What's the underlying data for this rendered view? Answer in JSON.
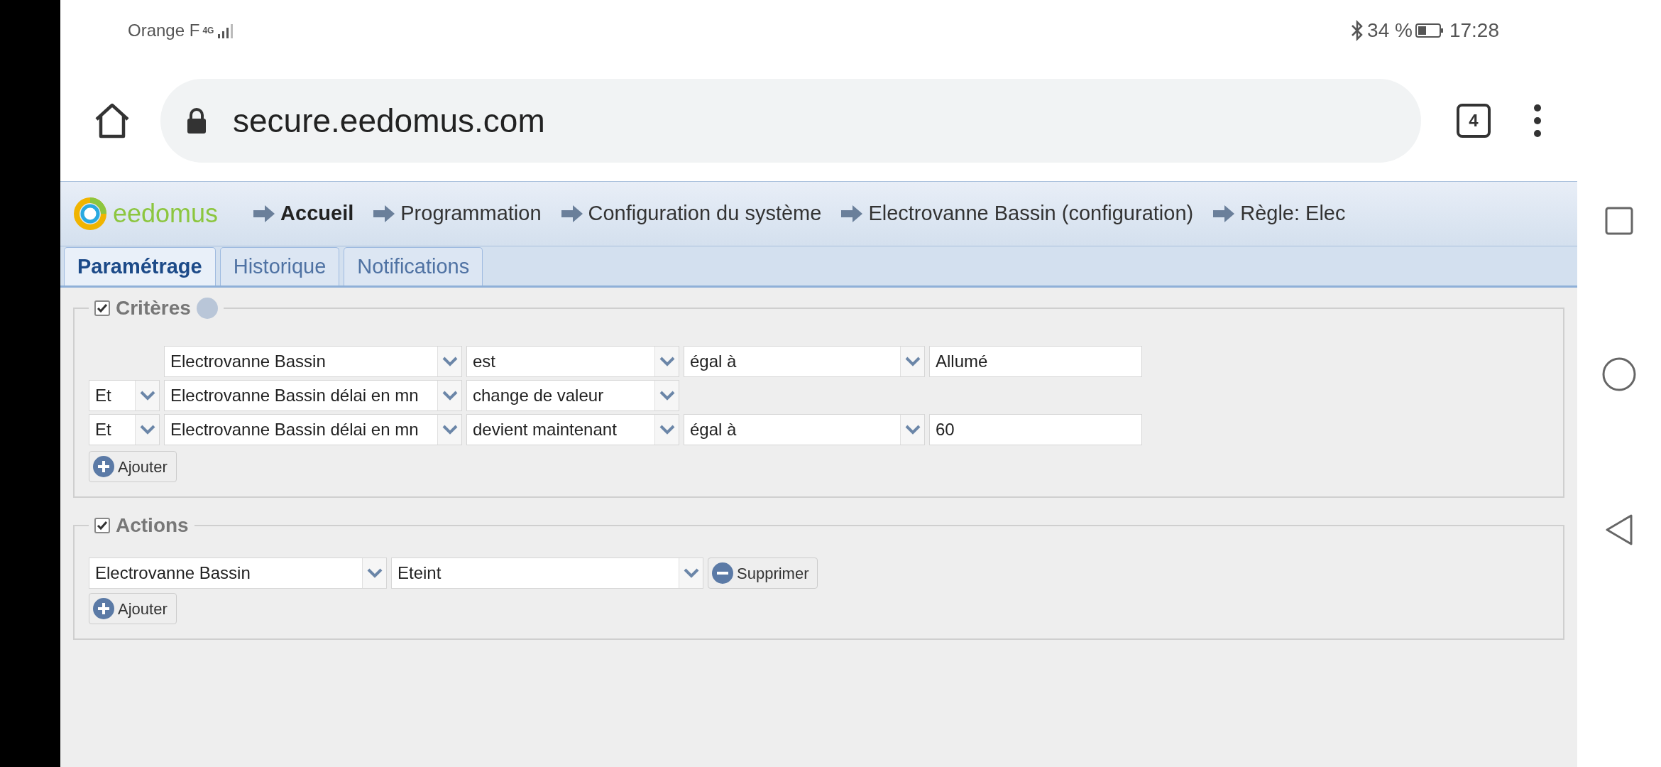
{
  "status_bar": {
    "carrier": "Orange F",
    "network": "4G",
    "battery": "34 %",
    "time": "17:28"
  },
  "browser": {
    "url": "secure.eedomus.com",
    "tab_count": "4"
  },
  "header": {
    "logo": "eedomus",
    "breadcrumbs": [
      {
        "label": "Accueil",
        "selected": true
      },
      {
        "label": "Programmation",
        "selected": false
      },
      {
        "label": "Configuration du système",
        "selected": false
      },
      {
        "label": "Electrovanne Bassin (configuration)",
        "selected": false
      },
      {
        "label": "Règle: Elec",
        "selected": false
      }
    ]
  },
  "tabs": [
    {
      "label": "Paramétrage",
      "selected": true
    },
    {
      "label": "Historique",
      "selected": false
    },
    {
      "label": "Notifications",
      "selected": false
    }
  ],
  "criteria": {
    "legend": "Critères",
    "checked": true,
    "rows": [
      {
        "device": "Electrovanne Bassin",
        "condition": "est",
        "comparison": "égal à",
        "value": "Allumé"
      },
      {
        "conjunction": "Et",
        "device": "Electrovanne Bassin délai en mn",
        "condition": "change de valeur"
      },
      {
        "conjunction": "Et",
        "device": "Electrovanne Bassin délai en mn",
        "condition": "devient maintenant",
        "comparison": "égal à",
        "value": "60"
      }
    ],
    "add_button": "Ajouter"
  },
  "actions": {
    "legend": "Actions",
    "checked": true,
    "rows": [
      {
        "device": "Electrovanne Bassin",
        "state": "Eteint",
        "remove_button": "Supprimer"
      }
    ],
    "add_button": "Ajouter"
  }
}
